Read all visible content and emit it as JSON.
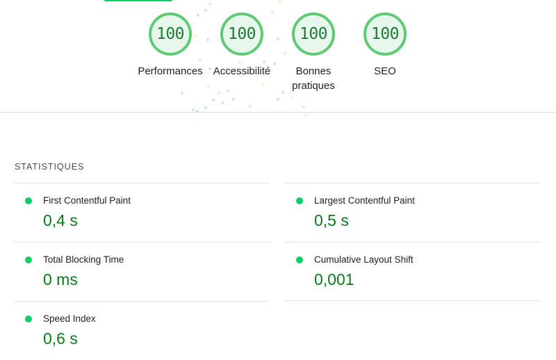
{
  "colors": {
    "pass_green": "#0cce6b",
    "score_text": "#1f7a36",
    "value_text": "#0a7a1a",
    "ring": "#5ecb74",
    "ring_fill": "#e8f7ec"
  },
  "gauges": [
    {
      "score": "100",
      "label": "Performances"
    },
    {
      "score": "100",
      "label": "Accessibilité"
    },
    {
      "score": "100",
      "label": "Bonnes pratiques"
    },
    {
      "score": "100",
      "label": "SEO"
    }
  ],
  "metrics": {
    "section_title": "STATISTIQUES",
    "items": [
      {
        "label": "First Contentful Paint",
        "value": "0,4 s"
      },
      {
        "label": "Largest Contentful Paint",
        "value": "0,5 s"
      },
      {
        "label": "Total Blocking Time",
        "value": "0 ms"
      },
      {
        "label": "Cumulative Layout Shift",
        "value": "0,001"
      },
      {
        "label": "Speed Index",
        "value": "0,6 s"
      }
    ]
  }
}
